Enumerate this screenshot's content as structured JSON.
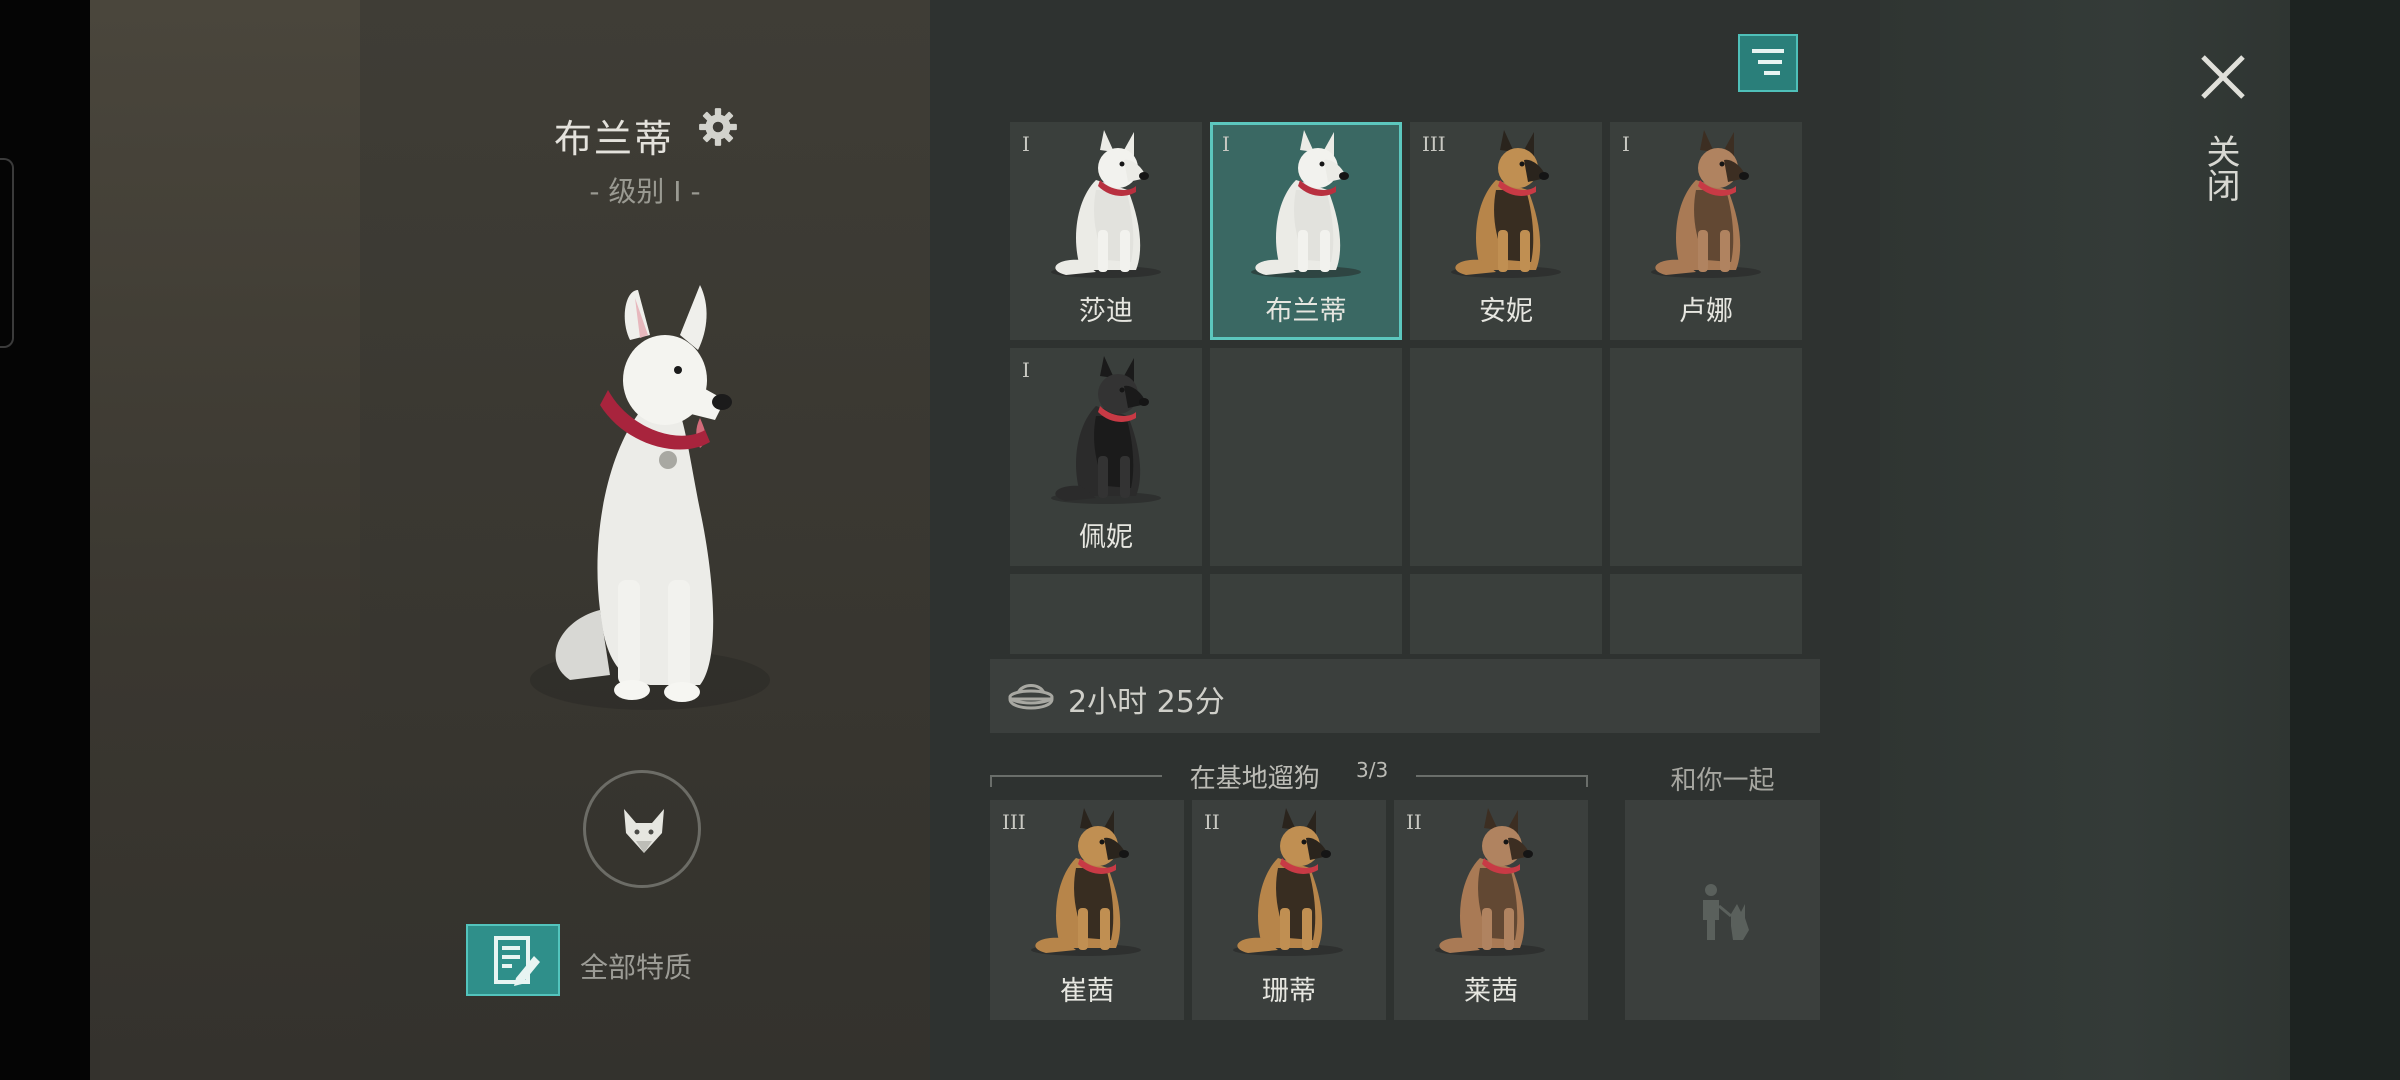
{
  "dog_detail": {
    "name": "布兰蒂",
    "level": "- 级别 I -"
  },
  "traits_label": "全部特质",
  "kennel": [
    {
      "rank": "I",
      "name": "莎迪",
      "coat": "white",
      "selected": false
    },
    {
      "rank": "I",
      "name": "布兰蒂",
      "coat": "white",
      "selected": true
    },
    {
      "rank": "III",
      "name": "安妮",
      "coat": "shepherd-dark",
      "selected": false
    },
    {
      "rank": "I",
      "name": "卢娜",
      "coat": "shepherd-tan",
      "selected": false
    },
    {
      "rank": "I",
      "name": "佩妮",
      "coat": "black",
      "selected": false
    }
  ],
  "timer": {
    "text": "2小时 25分"
  },
  "walk": {
    "title": "在基地遛狗",
    "count": "3/3",
    "dogs": [
      {
        "rank": "III",
        "name": "崔茜",
        "coat": "shepherd-dark"
      },
      {
        "rank": "II",
        "name": "珊蒂",
        "coat": "shepherd-dark"
      },
      {
        "rank": "II",
        "name": "莱茜",
        "coat": "shepherd-tan"
      }
    ]
  },
  "with_you_label": "和你一起",
  "close_label": "关闭",
  "colors": {
    "accent": "#2f8f8a",
    "accent_border": "#53c4bd",
    "selected_cell": "#3a6863"
  }
}
